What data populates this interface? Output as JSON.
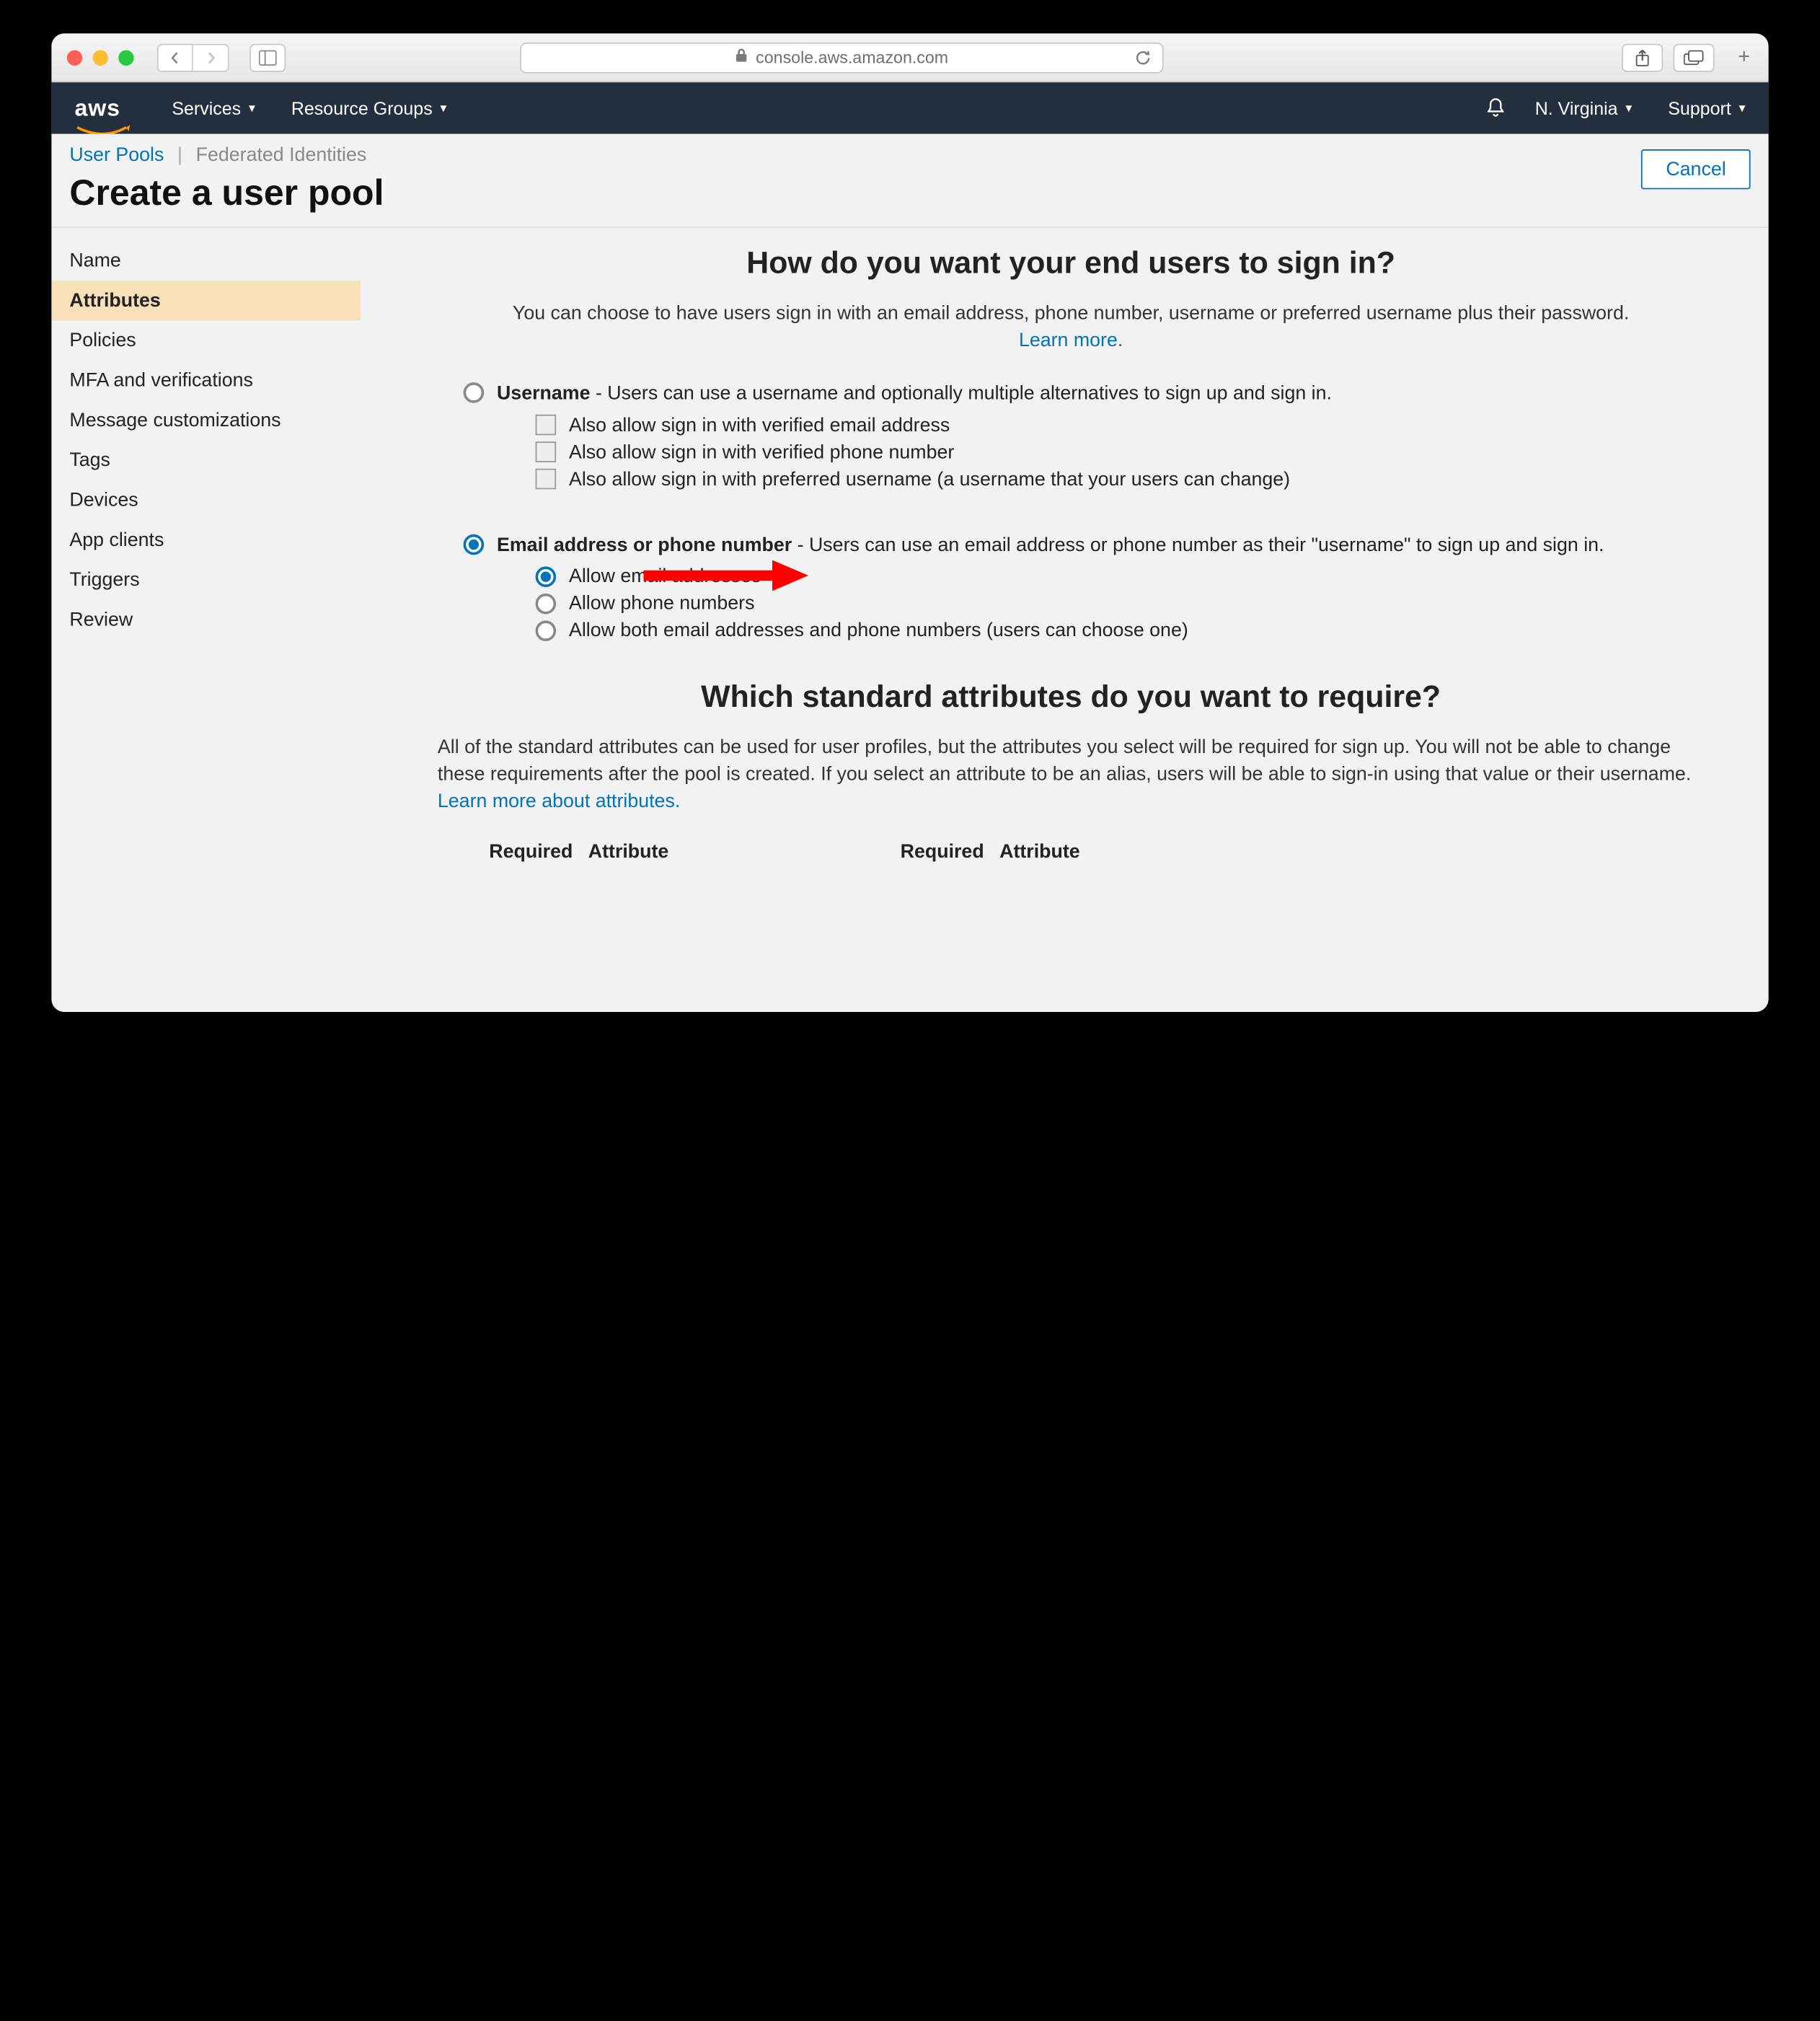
{
  "browser": {
    "url_host": "console.aws.amazon.com"
  },
  "aws_nav": {
    "services": "Services",
    "resource_groups": "Resource Groups",
    "region": "N. Virginia",
    "support": "Support"
  },
  "breadcrumbs": {
    "user_pools": "User Pools",
    "federated": "Federated Identities",
    "title": "Create a user pool",
    "cancel": "Cancel"
  },
  "sidebar": {
    "items": [
      "Name",
      "Attributes",
      "Policies",
      "MFA and verifications",
      "Message customizations",
      "Tags",
      "Devices",
      "App clients",
      "Triggers",
      "Review"
    ],
    "active_index": 1
  },
  "signin": {
    "heading": "How do you want your end users to sign in?",
    "lead": "You can choose to have users sign in with an email address, phone number, username or preferred username plus their password. ",
    "learn_more": "Learn more.",
    "option_username_bold": "Username",
    "option_username_rest": " - Users can use a username and optionally multiple alternatives to sign up and sign in.",
    "username_checks": [
      "Also allow sign in with verified email address",
      "Also allow sign in with verified phone number",
      "Also allow sign in with preferred username (a username that your users can change)"
    ],
    "option_email_bold": "Email address or phone number",
    "option_email_rest": " - Users can use an email address or phone number as their \"username\" to sign up and sign in.",
    "email_subs": [
      "Allow email addresses",
      "Allow phone numbers",
      "Allow both email addresses and phone numbers (users can choose one)"
    ],
    "email_sub_selected": 0
  },
  "attrs": {
    "heading": "Which standard attributes do you want to require?",
    "lead": "All of the standard attributes can be used for user profiles, but the attributes you select will be required for sign up. You will not be able to change these requirements after the pool is created. If you select an attribute to be an alias, users will be able to sign-in using that value or their username. ",
    "learn_more": "Learn more about attributes.",
    "col_required": "Required",
    "col_attribute": "Attribute"
  }
}
